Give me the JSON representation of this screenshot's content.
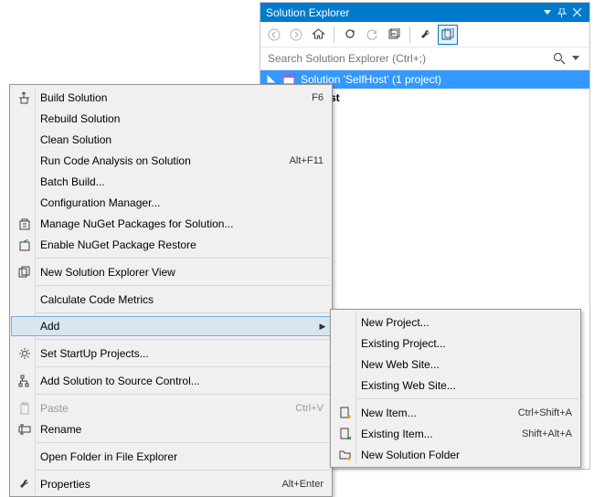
{
  "panel": {
    "title": "Solution Explorer",
    "search_placeholder": "Search Solution Explorer (Ctrl+;)"
  },
  "tree": {
    "solution_label": "Solution 'SelfHost' (1 project)",
    "project_label": "Host"
  },
  "menu": {
    "build_solution": "Build Solution",
    "build_solution_key": "F6",
    "rebuild_solution": "Rebuild Solution",
    "clean_solution": "Clean Solution",
    "run_code_analysis": "Run Code Analysis on Solution",
    "run_code_analysis_key": "Alt+F11",
    "batch_build": "Batch Build...",
    "configuration_manager": "Configuration Manager...",
    "manage_nuget": "Manage NuGet Packages for Solution...",
    "enable_nuget_restore": "Enable NuGet Package Restore",
    "new_solution_explorer_view": "New Solution Explorer View",
    "calculate_code_metrics": "Calculate Code Metrics",
    "add": "Add",
    "set_startup": "Set StartUp Projects...",
    "add_to_source_control": "Add Solution to Source Control...",
    "paste": "Paste",
    "paste_key": "Ctrl+V",
    "rename": "Rename",
    "open_in_explorer": "Open Folder in File Explorer",
    "properties": "Properties",
    "properties_key": "Alt+Enter"
  },
  "submenu": {
    "new_project": "New Project...",
    "existing_project": "Existing Project...",
    "new_web_site": "New Web Site...",
    "existing_web_site": "Existing Web Site...",
    "new_item": "New Item...",
    "new_item_key": "Ctrl+Shift+A",
    "existing_item": "Existing Item...",
    "existing_item_key": "Shift+Alt+A",
    "new_solution_folder": "New Solution Folder"
  }
}
